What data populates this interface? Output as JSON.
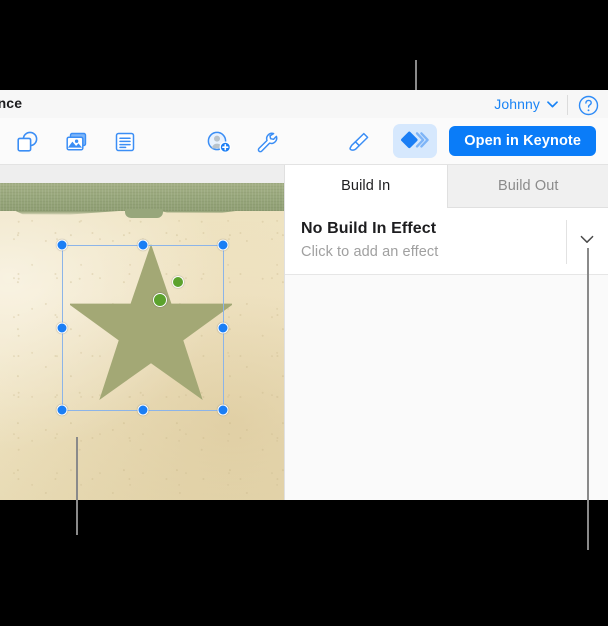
{
  "window": {
    "document_title": "ssance",
    "account": {
      "name": "Johnny",
      "chevron_icon": "chevron-down-icon"
    },
    "help_icon": "question-mark-circle-icon"
  },
  "toolbar": {
    "items": [
      {
        "id": "shape",
        "icon": "shape-icon",
        "label": "Shape",
        "active": false
      },
      {
        "id": "media",
        "icon": "media-image-icon",
        "label": "Media",
        "active": false
      },
      {
        "id": "text",
        "icon": "text-box-icon",
        "label": "Text",
        "active": false
      },
      {
        "id": "comment",
        "icon": "add-comment-icon",
        "label": "Comment",
        "active": false
      },
      {
        "id": "format",
        "icon": "wrench-icon",
        "label": "Format",
        "active": false
      },
      {
        "id": "paint",
        "icon": "paintbrush-icon",
        "label": "Paintbrush",
        "active": false
      },
      {
        "id": "animate",
        "icon": "animate-icon",
        "label": "Animate",
        "active": true
      }
    ],
    "open_in_keynote_label": "Open in Keynote"
  },
  "panel": {
    "tabs": [
      {
        "id": "build-in",
        "label": "Build In",
        "active": true
      },
      {
        "id": "build-out",
        "label": "Build Out",
        "active": false
      }
    ],
    "effect": {
      "title": "No Build In Effect",
      "subtitle": "Click to add an effect",
      "chevron_icon": "chevron-down-icon"
    }
  },
  "canvas": {
    "slide_background_color": "#f0e4c4",
    "cloth_band_color": "#99a87d",
    "shape": {
      "type": "star-shape",
      "fill_color": "#a3a875",
      "selection_handle_color": "#1a7ef5",
      "adjust_handle_color": "#5ca22d",
      "handle_count": 8,
      "adjust_handle_count": 2
    }
  },
  "colors": {
    "accent_blue": "#0a7cf8",
    "highlight_blue": "#d6e8fd",
    "leader_gray": "#8a8a8a"
  }
}
